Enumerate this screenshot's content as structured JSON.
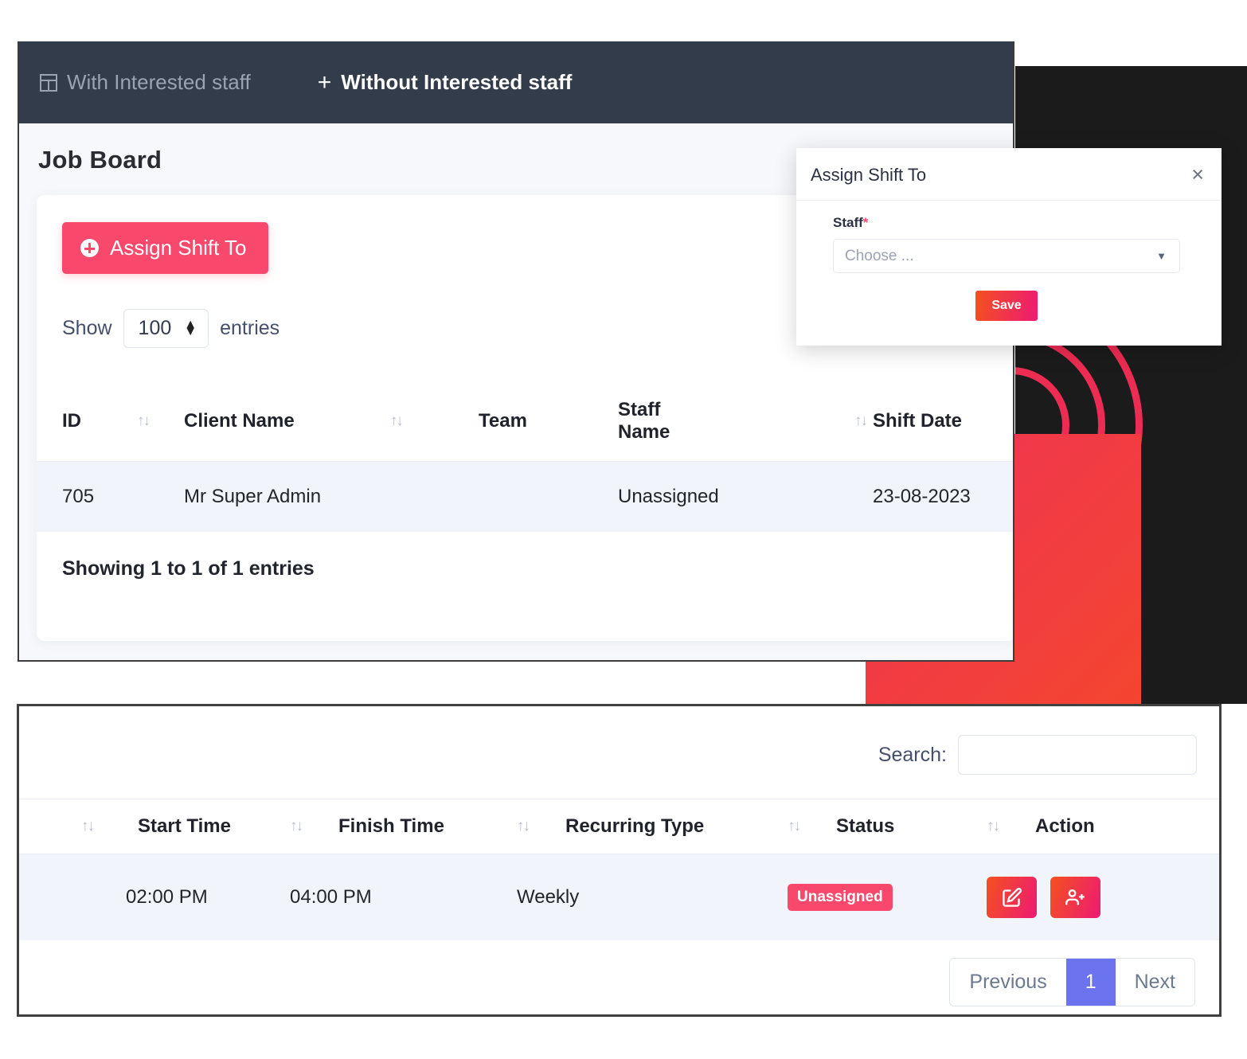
{
  "topbar": {
    "tab_with_label": "With Interested staff",
    "tab_without_label": "Without Interested staff",
    "grid_icon": "table-grid-icon",
    "plus_icon": "plus-icon"
  },
  "page": {
    "title": "Job Board"
  },
  "toolbar": {
    "assign_label": "Assign Shift To",
    "show_label": "Show",
    "show_value": "100",
    "entries_label": "entries"
  },
  "table_top": {
    "headers": [
      "ID",
      "Client Name",
      "Team",
      "Staff Name",
      "Shift Date"
    ],
    "rows": [
      {
        "id": "705",
        "client_name": "Mr Super Admin",
        "team": "",
        "staff_name": "Unassigned",
        "shift_date": "23-08-2023"
      }
    ],
    "showing": "Showing 1 to 1 of 1 entries"
  },
  "modal": {
    "title": "Assign Shift To",
    "close_icon": "close-icon",
    "field_label": "Staff",
    "required_mark": "*",
    "select_placeholder": "Choose ...",
    "caret_icon": "chevron-down-icon",
    "save_label": "Save"
  },
  "table_bottom": {
    "search_label": "Search:",
    "search_value": "",
    "search_placeholder": "",
    "headers": [
      "Start Time",
      "Finish Time",
      "Recurring Type",
      "Status",
      "Action"
    ],
    "rows": [
      {
        "start_time": "02:00 PM",
        "finish_time": "04:00 PM",
        "recurring_type": "Weekly",
        "status": "Unassigned",
        "actions": [
          "edit-icon",
          "assign-user-icon"
        ]
      }
    ],
    "pagination": {
      "previous": "Previous",
      "current": "1",
      "next": "Next"
    }
  },
  "colors": {
    "accent_pink": "#f8486c",
    "accent_orange": "#f4511f",
    "topbar_dark": "#333c4a",
    "deco_black": "#1b1b1b",
    "link_blue": "#7b85e8",
    "pager_active": "#6b74ee"
  }
}
